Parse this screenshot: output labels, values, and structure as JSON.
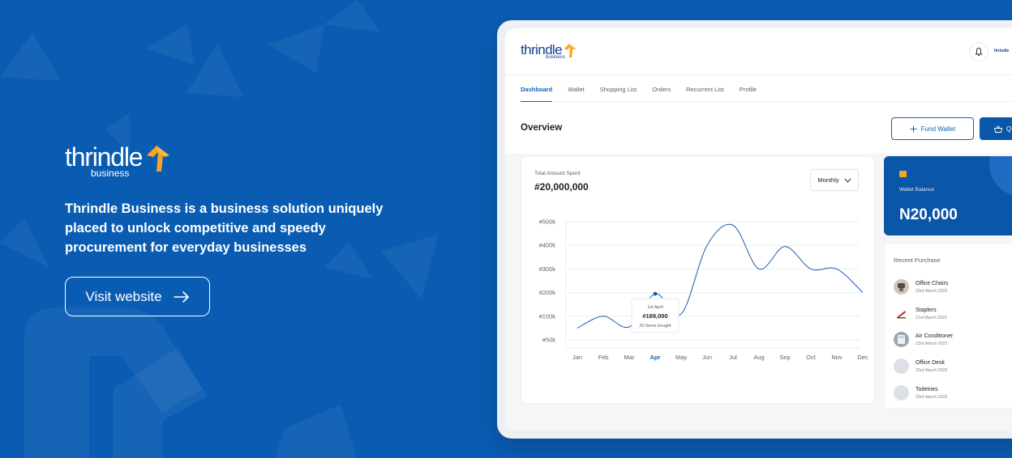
{
  "hero": {
    "brand_word": "thrindle",
    "brand_sub": "business",
    "tagline": "Thrindle Business is a business solution uniquely placed to unlock competitive and speedy procurement for everyday businesses",
    "visit_label": "Visit website"
  },
  "app": {
    "brand_word": "thrindle",
    "brand_sub": "business",
    "avatar_text": "thrindle",
    "tabs": [
      {
        "label": "Dashboard",
        "active": true
      },
      {
        "label": "Wallet",
        "active": false
      },
      {
        "label": "Shopping List",
        "active": false
      },
      {
        "label": "Orders",
        "active": false
      },
      {
        "label": "Recurrent List",
        "active": false
      },
      {
        "label": "Profile",
        "active": false
      }
    ],
    "overview_title": "Overview",
    "fund_wallet_label": "Fund Wallet",
    "quick_label": "Q",
    "chart_card": {
      "label": "Total Amount Spent",
      "total": "#20,000,000",
      "period": "Monthly"
    },
    "wallet": {
      "label": "Wallet Balance",
      "balance": "N20,000"
    },
    "recent": {
      "title": "Recent Purchase",
      "items": [
        {
          "name": "Office Chairs",
          "date": "23rd March 2023",
          "icon": "chair-icon"
        },
        {
          "name": "Staplers",
          "date": "21st March 2023",
          "icon": "stapler-icon"
        },
        {
          "name": "Air Conditioner",
          "date": "23rd March 2023",
          "icon": "air-conditioner-icon"
        },
        {
          "name": "Office Desk",
          "date": "23rd March 2023",
          "icon": "desk-icon"
        },
        {
          "name": "Toiletries",
          "date": "23rd March 2023",
          "icon": "toiletries-icon"
        }
      ]
    }
  },
  "chart_data": {
    "type": "line",
    "title": "",
    "categories": [
      "Jan",
      "Feb",
      "Mar",
      "Apr",
      "May",
      "Jun",
      "Jul",
      "Aug",
      "Sep",
      "Oct",
      "Nov",
      "Dec"
    ],
    "y_tick_labels": [
      "#500k",
      "#400k",
      "#300k",
      "#200k",
      "#100k",
      "#50k"
    ],
    "y_tick_values": [
      500,
      400,
      300,
      200,
      100,
      0
    ],
    "highlight_category": "Apr",
    "series": [
      {
        "values": [
          50,
          100,
          55,
          195,
          110,
          400,
          485,
          300,
          395,
          300,
          300,
          200
        ]
      }
    ],
    "tooltip": {
      "date": "1st April",
      "amount": "#189,000",
      "detail": "20 Items bought"
    },
    "colors": {
      "line": "#1a5fb0",
      "grid": "#eceef2",
      "highlight": "#1560b8"
    }
  },
  "colors": {
    "background": "#0a5cb3",
    "accent": "#f5a623",
    "primary": "#0a56a8"
  }
}
